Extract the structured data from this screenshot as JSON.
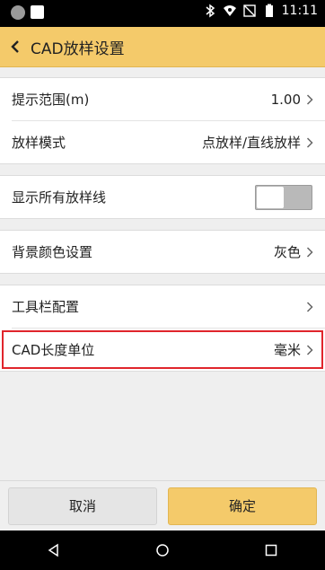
{
  "status_bar": {
    "time": "11:11",
    "icons": [
      "notification-dot-icon",
      "notification-square-icon",
      "bluetooth-icon",
      "wifi-icon",
      "no-sim-icon",
      "battery-icon"
    ]
  },
  "header": {
    "title": "CAD放样设置",
    "back_icon": "chevron-left-icon",
    "background_color": "#f4ca6a"
  },
  "settings": [
    {
      "label": "提示范围(m)",
      "value": "1.00"
    },
    {
      "label": "放样模式",
      "value": "点放样/直线放样"
    },
    {
      "label": "显示所有放样线",
      "toggle": false
    },
    {
      "label": "背景颜色设置",
      "value": "灰色"
    },
    {
      "label": "工具栏配置",
      "value": ""
    },
    {
      "label": "CAD长度单位",
      "value": "毫米",
      "highlighted": true
    }
  ],
  "buttons": {
    "cancel": "取消",
    "ok": "确定"
  },
  "nav_bar": [
    "back-triangle-icon",
    "home-circle-icon",
    "recents-square-icon"
  ],
  "colors": {
    "accent": "#f4ca6a",
    "highlight_border": "#e0252c"
  }
}
